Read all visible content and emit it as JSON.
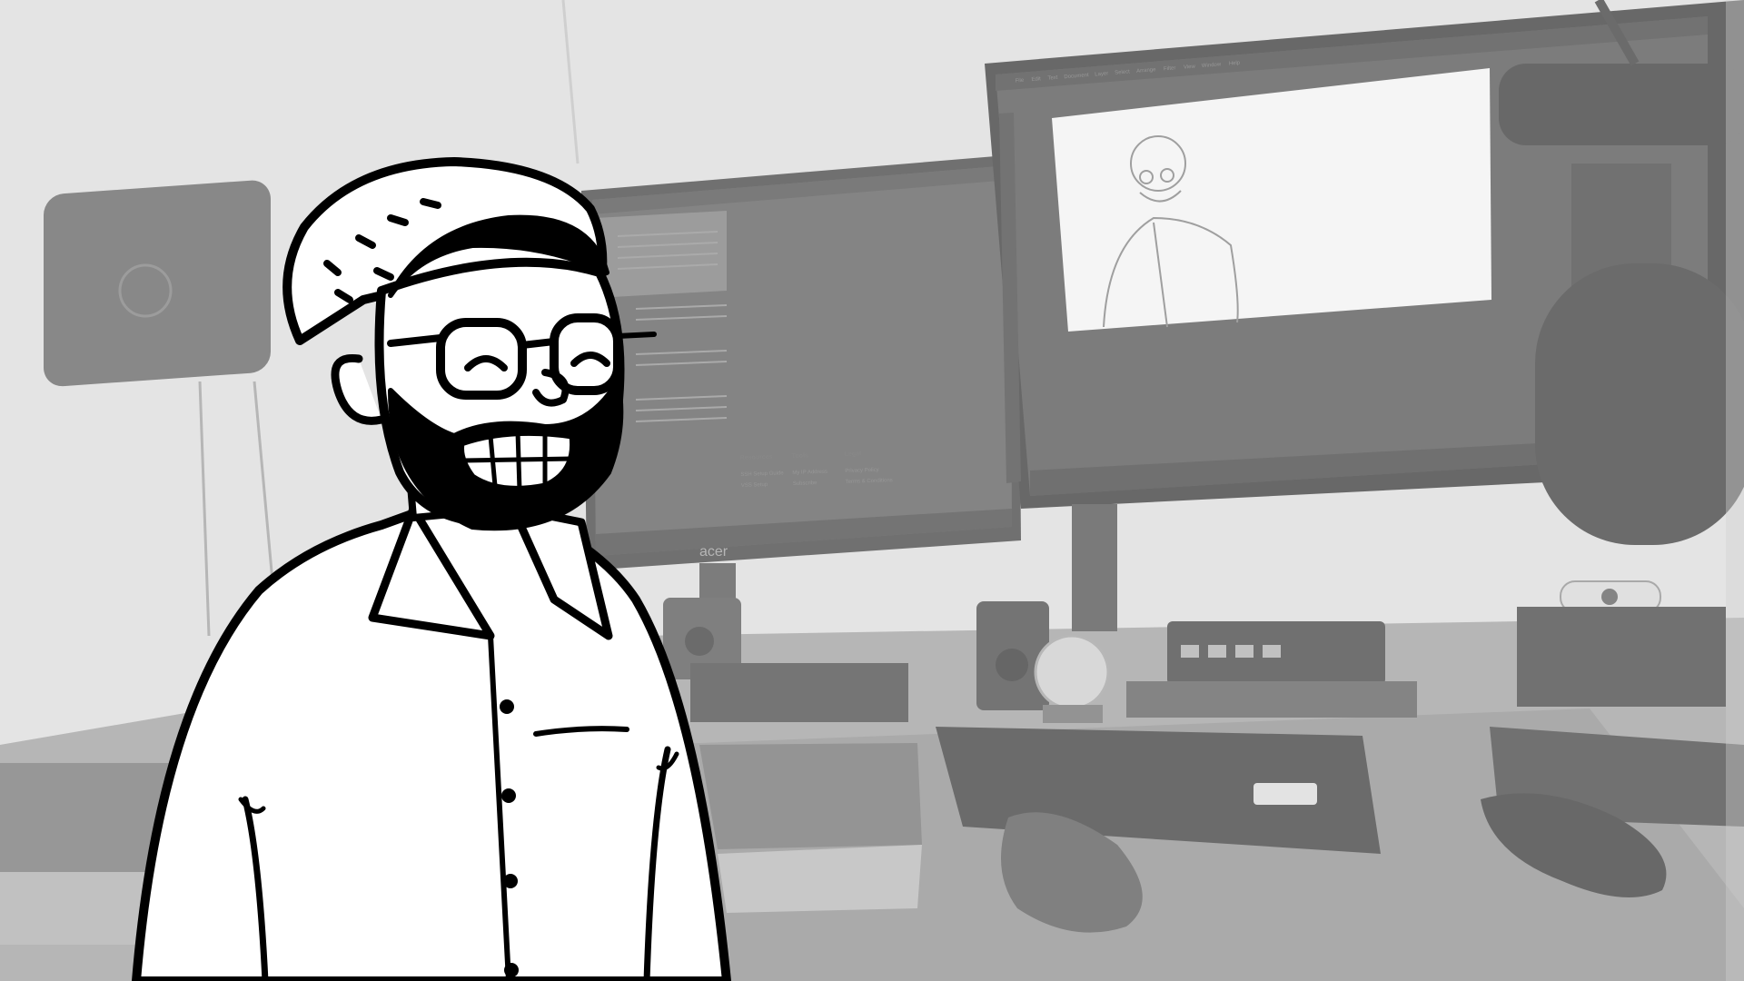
{
  "background": {
    "wall_color": "#d8d8d8",
    "desk_color": "#8f8f8f",
    "mat_color": "#7b7b7b",
    "monitor_frame_color": "#3a3a3a"
  },
  "left_monitor": {
    "brand": "acer",
    "footer": {
      "col1_title": "Resources",
      "col1_items": [
        "SSH Setup Guide",
        "VSS Setup"
      ],
      "col2_title": "Tools",
      "col2_items": [
        "My IP Address",
        "Subscribe"
      ],
      "col3_title": "Legal",
      "col3_items": [
        "Privacy Policy",
        "Terms & Conditions"
      ]
    }
  },
  "right_monitor": {
    "menu_items": [
      "File",
      "Edit",
      "Text",
      "Document",
      "Layer",
      "Select",
      "Arrange",
      "Filter",
      "View",
      "Window",
      "Help"
    ]
  },
  "character": {
    "description_icon": "bearded-man-with-glasses-cartoon",
    "outline_color": "#000000",
    "fill_color": "#ffffff"
  },
  "desk_items": {
    "keyboard_brand_icon": "keyboard-icon",
    "mouse_icon": "mouse-icon",
    "router_icon": "network-switch-icon",
    "microphone_icon": "microphone-icon"
  }
}
